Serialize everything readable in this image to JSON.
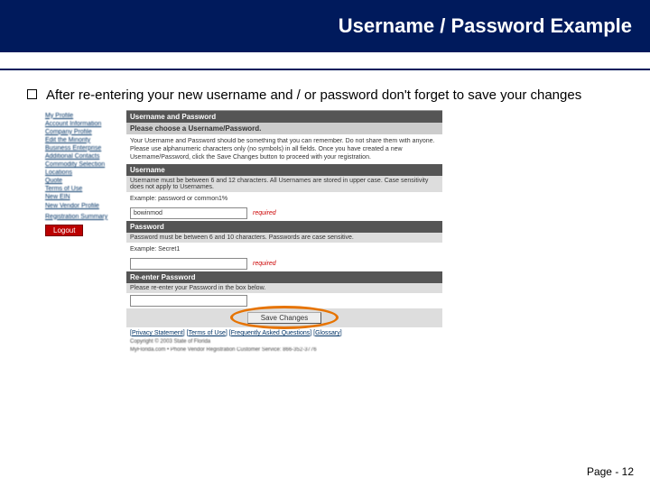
{
  "title": "Username / Password Example",
  "bullet_text": "After re-entering your new username and / or password don't forget to save your changes",
  "page_number": "Page - 12",
  "sidebar": {
    "items": [
      "My Profile",
      "Account Information",
      "Company Profile",
      "Edit the Minority",
      "Business Enterprise",
      "Additional Contacts",
      "Commodity Selection",
      "Locations",
      "Quote",
      "Terms of Use",
      "New EIN",
      "New Vendor Profile"
    ],
    "summary": "Registration Summary",
    "logout": "Logout"
  },
  "panel": {
    "header": "Username and Password",
    "choose": "Please choose a Username/Password.",
    "intro": "Your Username and Password should be something that you can remember. Do not share them with anyone. Please use alphanumeric characters only (no symbols) in all fields. Once you have created a new Username/Password, click the Save Changes button to proceed with your registration.",
    "username_header": "Username",
    "username_rule": "Username must be between 6 and 12 characters. All Usernames are stored in upper case. Case sensitivity does not apply to Usernames.",
    "username_example": "Example: password  or common1%",
    "username_value": "bowinmod",
    "required": "required",
    "password_header": "Password",
    "password_rule": "Password must be between 6 and 10 characters. Passwords are case sensitive.",
    "password_example": "Example: Secret1",
    "reenter_header": "Re-enter Password",
    "reenter_rule": "Please re-enter your Password in the box below.",
    "save_btn": "Save Changes",
    "footer_links": [
      "Privacy Statement",
      "Terms of Use",
      "Frequently Asked Questions",
      "Glossary"
    ],
    "copyright": "Copyright © 2003 State of Florida",
    "service": "MyFlorida.com • Phone Vendor Registration Customer Service: 866-352-3776"
  }
}
